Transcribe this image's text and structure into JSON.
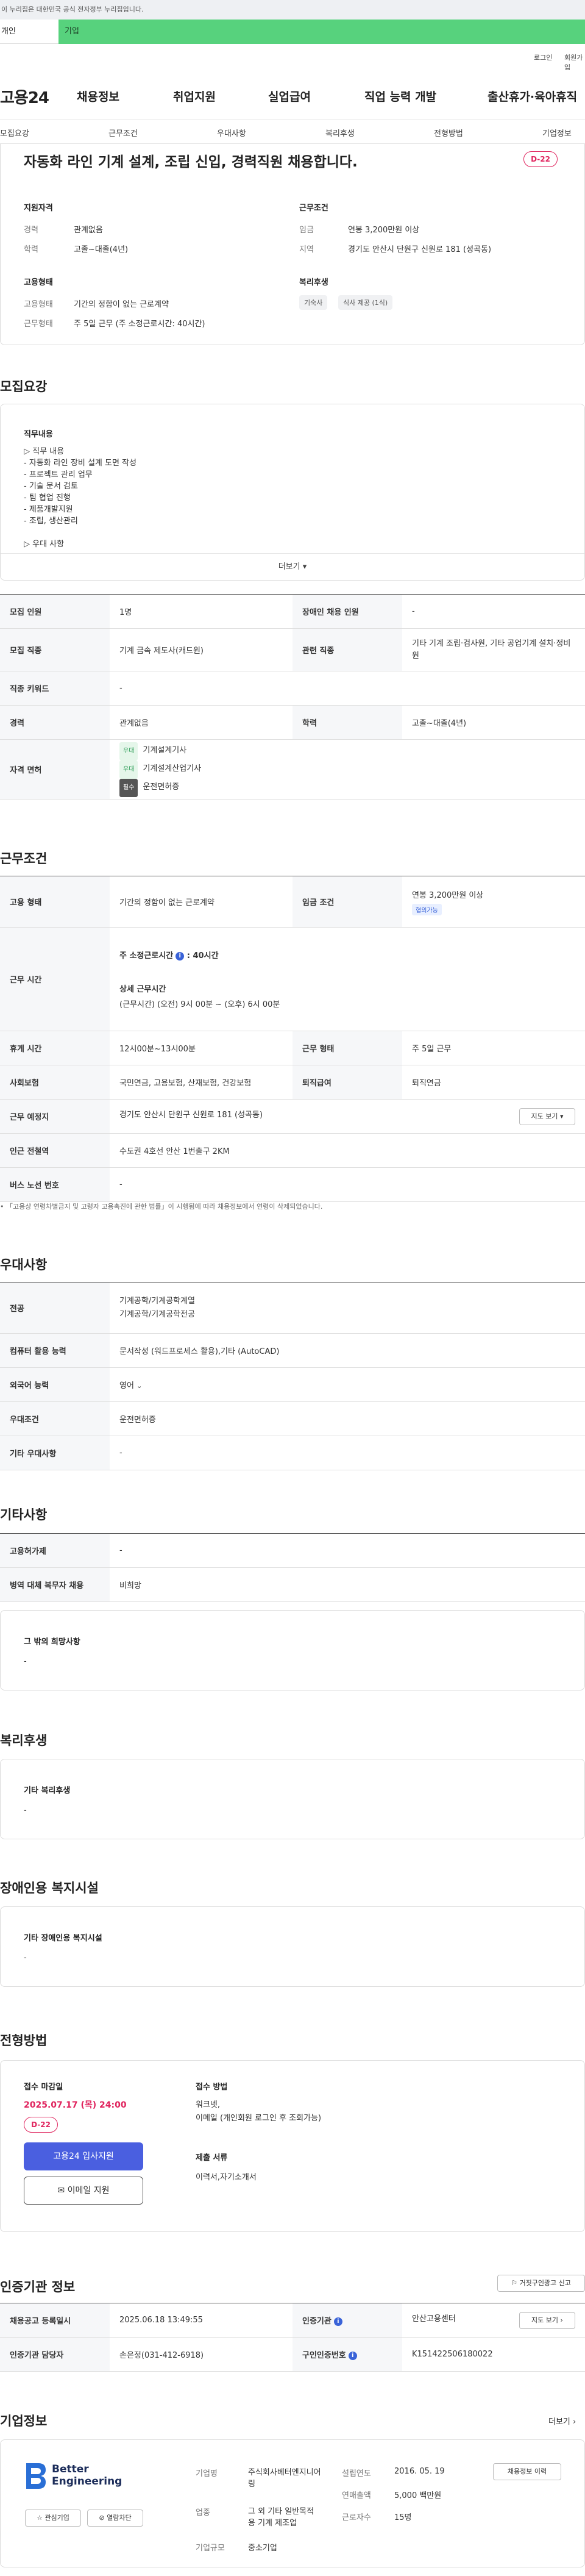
{
  "gov_banner": "이 누리집은 대한민국 공식 전자정부 누리집입니다.",
  "tabs": {
    "personal": "개인",
    "company": "기업"
  },
  "util": {
    "login": "로그인",
    "signup": "회원가입"
  },
  "gnb": {
    "logo": "고용24",
    "items": [
      "채용정보",
      "취업지원",
      "실업급여",
      "직업 능력 개발",
      "출산휴가·육아휴직"
    ]
  },
  "subnav": [
    "모집요강",
    "근무조건",
    "우대사항",
    "복리후생",
    "전형방법",
    "기업정보"
  ],
  "summary": {
    "title": "자동화 라인 기계 설계, 조립 신입, 경력직원 채용합니다.",
    "dday": "D-22",
    "qual_title": "지원자격",
    "career_k": "경력",
    "career_v": "관계없음",
    "edu_k": "학력",
    "edu_v": "고졸~대졸(4년)",
    "emp_title": "고용형태",
    "emptype_k": "고용형태",
    "emptype_v": "기간의 정함이 없는 근로계약",
    "worktype_k": "근무형태",
    "worktype_v": "주 5일 근무 (주 소정근로시간: 40시간)",
    "cond_title": "근무조건",
    "wage_k": "임금",
    "wage_v": "연봉 3,200만원 이상",
    "region_k": "지역",
    "region_v": "경기도 안산시 단원구 신원로 181 (성곡동)",
    "welfare_title": "복리후생",
    "welfare_chips": [
      "기숙사",
      "식사 제공 (1식)"
    ]
  },
  "recruit": {
    "title": "모집요강",
    "duties_title": "직무내용",
    "duties_lines": [
      "▷ 직무 내용",
      "- 자동화 라인 장비 설계 도면 작성",
      "- 프로젝트 관리 업무",
      "- 기술 문서 검토",
      "- 팀 협업 진행",
      "- 제품개발지원",
      "- 조립, 생산관리",
      "",
      "▷ 우대 사항"
    ],
    "more": "더보기",
    "rows": {
      "count_k": "모집 인원",
      "count_v": "1명",
      "disabled_k": "장애인 채용 인원",
      "disabled_v": "-",
      "job_k": "모집 직종",
      "job_v": "기계 금속 제도사(캐드원)",
      "related_k": "관련 직종",
      "related_v": "기타 기계 조립·검사원, 기타 공업기계 설치·정비원",
      "keyword_k": "직종 키워드",
      "keyword_v": "-",
      "career_k": "경력",
      "career_v": "관계없음",
      "edu_k": "학력",
      "edu_v": "고졸~대졸(4년)",
      "license_k": "자격 면허",
      "licenses": [
        {
          "badge": "우대",
          "name": "기계설계기사"
        },
        {
          "badge": "우대",
          "name": "기계설계산업기사"
        },
        {
          "badge": "필수",
          "name": "운전면허증"
        }
      ]
    }
  },
  "conditions": {
    "title": "근무조건",
    "emptype_k": "고용 형태",
    "emptype_v": "기간의 정함이 없는 근로계약",
    "wage_k": "임금 조건",
    "wage_v": "연봉 3,200만원 이상",
    "wage_badge": "협의가능",
    "hours_k": "근무 시간",
    "hours_weekly": "주 소정근로시간",
    "hours_weekly_v": "40시간",
    "hours_detail_title": "상세 근무시간",
    "hours_detail": "(근무시간) (오전) 9시 00분 ~ (오후) 6시 00분",
    "break_k": "휴게 시간",
    "break_v": "12시00분~13시00분",
    "shift_k": "근무 형태",
    "shift_v": "주 5일 근무",
    "insurance_k": "사회보험",
    "insurance_v": "국민연금, 고용보험, 산재보험, 건강보험",
    "retire_k": "퇴직급여",
    "retire_v": "퇴직연금",
    "place_k": "근무 예정지",
    "place_v": "경기도 안산시 단원구 신원로 181 (성곡동)",
    "map_btn": "지도 보기",
    "subway_k": "인근 전철역",
    "subway_v": "수도권 4호선 안산 1번출구 2KM",
    "bus_k": "버스 노선 번호",
    "bus_v": "-",
    "footnote": "「고용상 연령차별금지 및 고령자 고용촉진에 관한 법률」이 시행됨에 따라 채용정보에서 연령이 삭제되었습니다."
  },
  "preferred": {
    "title": "우대사항",
    "major_k": "전공",
    "major_v1": "기계공학/기계공학계열",
    "major_v2": "기계공학/기계공학전공",
    "computer_k": "컴퓨터 활용 능력",
    "computer_v": "문서작성 (워드프로세스 활용),기타 (AutoCAD)",
    "lang_k": "외국어 능력",
    "lang_v": "영어",
    "cond_k": "우대조건",
    "cond_v": "운전면허증",
    "etc_k": "기타 우대사항",
    "etc_v": "-"
  },
  "others": {
    "title": "기타사항",
    "equip_k": "고용허가제",
    "equip_v": "-",
    "military_k": "병역 대체 복무자 채용",
    "military_v": "비희망",
    "hope_title": "그 밖의 희망사항",
    "hope_v": "-"
  },
  "welfare": {
    "title": "복리후생",
    "box_title": "기타 복리후생",
    "box_v": "-"
  },
  "disabled": {
    "title": "장애인용 복지시설",
    "box_title": "기타 장애인용 복지시설",
    "box_v": "-"
  },
  "process": {
    "title": "전형방법",
    "deadline_title": "접수 마감일",
    "deadline": "2025.07.17 (목) 24:00",
    "dday": "D-22",
    "apply_btn": "고용24 입사지원",
    "email_btn": "이메일 지원",
    "method_title": "접수 방법",
    "method_lines": [
      "워크넷,",
      "이메일 (개인회원 로그인 후 조회가능)"
    ],
    "docs_title": "제출 서류",
    "docs_v": "이력서,자기소개서"
  },
  "agency": {
    "title": "인증기관 정보",
    "report_btn": "거짓구인광고 신고",
    "regdate_k": "채용공고 등록일시",
    "regdate_v": "2025.06.18 13:49:55",
    "org_k": "인증기관",
    "org_v": "안산고용센터",
    "manager_k": "인증기관 담당자",
    "manager_v": "손은정(031-412-6918)",
    "num_k": "구인인증번호",
    "num_v": "K151422506180022",
    "map_btn": "지도 보기"
  },
  "company": {
    "title": "기업정보",
    "more": "더보기",
    "logo_line1": "Better",
    "logo_line2": "Engineering",
    "interest_btn": "관심기업",
    "block_btn": "열람차단",
    "name_k": "기업명",
    "name_v": "주식회사베터엔지니어링",
    "industry_k": "업종",
    "industry_v": "그 외 기타 일반목적용 기계 제조업",
    "scale_k": "기업규모",
    "scale_v": "중소기업",
    "est_k": "설립연도",
    "est_v": "2016. 05. 19",
    "sales_k": "연매출액",
    "sales_v": "5,000 백만원",
    "emp_k": "근로자수",
    "emp_v": "15명",
    "jobs_btn": "채용정보 이력"
  },
  "colors": {
    "accent": "#4a5fe0",
    "dday": "#e0245e",
    "company_tab": "#57d27d"
  }
}
